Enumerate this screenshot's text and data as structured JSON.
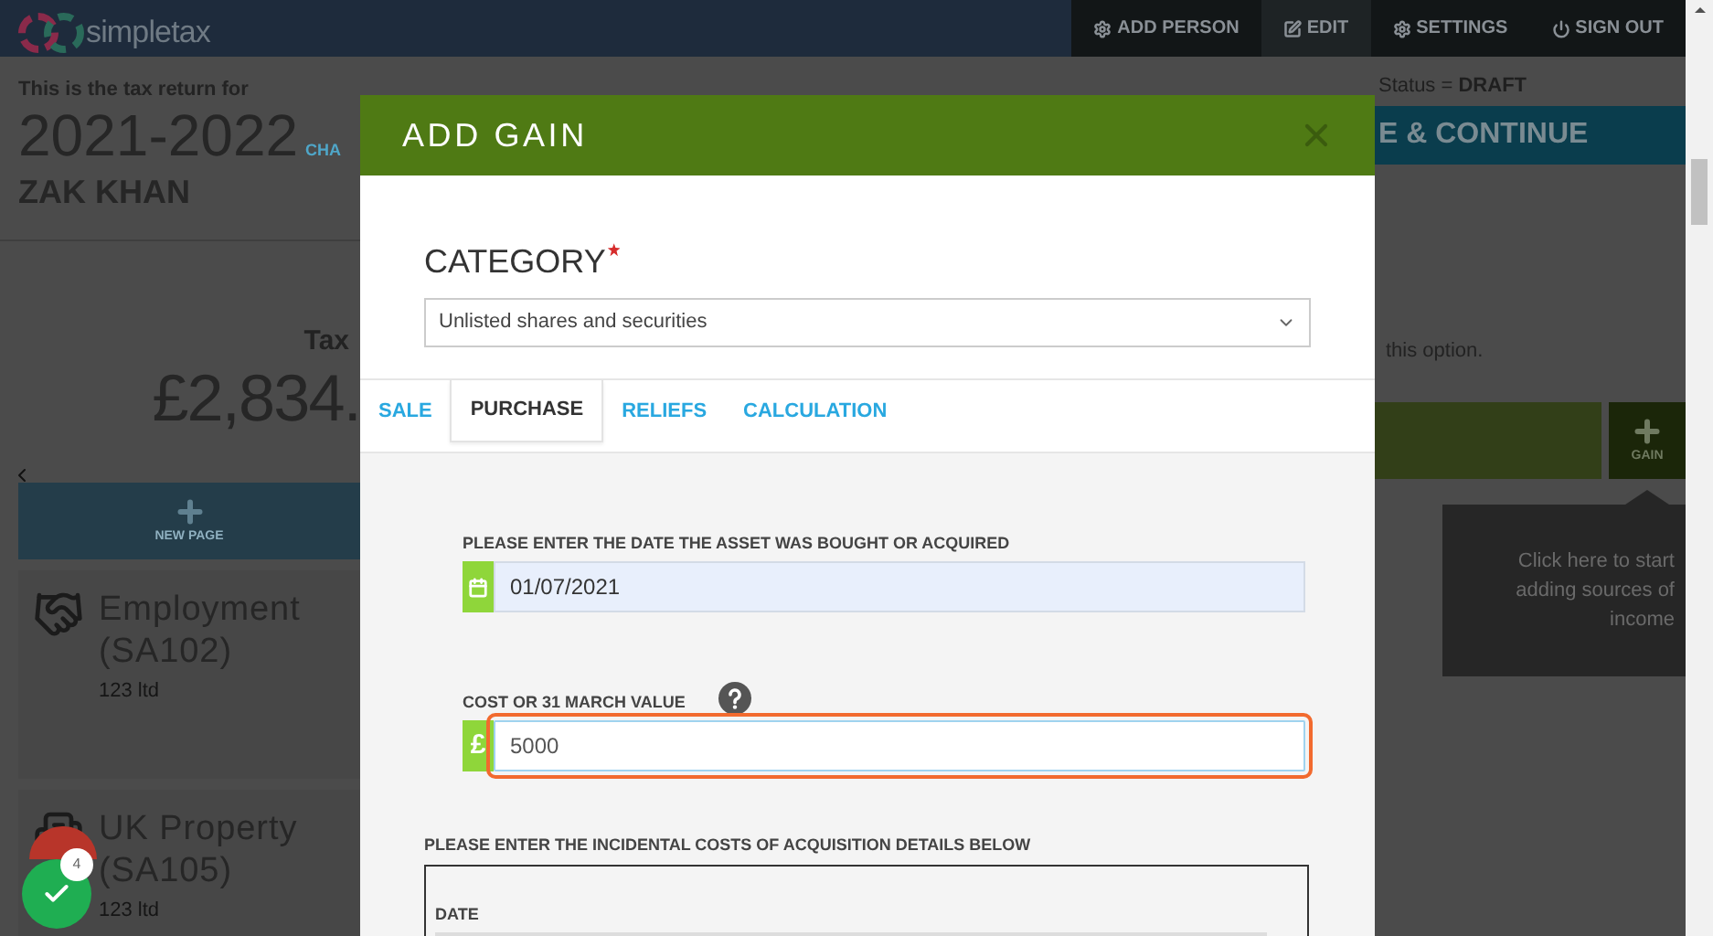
{
  "header": {
    "logo_text": "simpletax",
    "nav": [
      {
        "label": "ADD PERSON",
        "kind": "gear",
        "selected": false
      },
      {
        "label": "EDIT",
        "kind": "edit",
        "selected": true
      },
      {
        "label": "SETTINGS",
        "kind": "gear",
        "selected": false
      },
      {
        "label": "SIGN OUT",
        "kind": "power",
        "selected": false
      }
    ]
  },
  "summary": {
    "intro": "This is the tax return for",
    "tax_year": "2021-2022",
    "change_link": "CHA",
    "name": "ZAK KHAN",
    "tax_label": "Tax",
    "tax_amount": "£2,834.",
    "new_page": "NEW PAGE",
    "sources": [
      {
        "title": "Employment (SA102)",
        "subtitle": "123 ltd",
        "kind": "handshake"
      },
      {
        "title": "UK Property (SA105)",
        "subtitle": "123 ltd",
        "kind": "building"
      }
    ]
  },
  "side": {
    "status": "Status = **DRAFT**",
    "save_button": "E & CONTINUE",
    "option_note": "this option.",
    "gain_button": "GAIN",
    "tooltip": "Click here to start adding sources of income"
  },
  "modal": {
    "title": "ADD GAIN",
    "category": {
      "label": "CATEGORY",
      "required": true,
      "value": "Unlisted shares and securities"
    },
    "tabs": [
      {
        "label": "SALE",
        "selected": false
      },
      {
        "label": "PURCHASE",
        "selected": true
      },
      {
        "label": "RELIEFS",
        "selected": false
      },
      {
        "label": "CALCULATION",
        "selected": false
      }
    ],
    "fields": [
      {
        "label": "PLEASE ENTER THE DATE THE ASSET WAS BOUGHT OR ACQUIRED",
        "kind": "date",
        "value": "01/07/2021",
        "help": false,
        "highlighted": false
      },
      {
        "label": "COST OR 31 MARCH VALUE",
        "kind": "currency",
        "prefix": "£",
        "value": "5000",
        "help": true,
        "highlighted": true
      }
    ],
    "incidental": {
      "label": "PLEASE ENTER THE INCIDENTAL COSTS OF ACQUISITION DETAILS BELOW",
      "date_label": "DATE"
    }
  },
  "help_widget": {
    "count": "4"
  }
}
